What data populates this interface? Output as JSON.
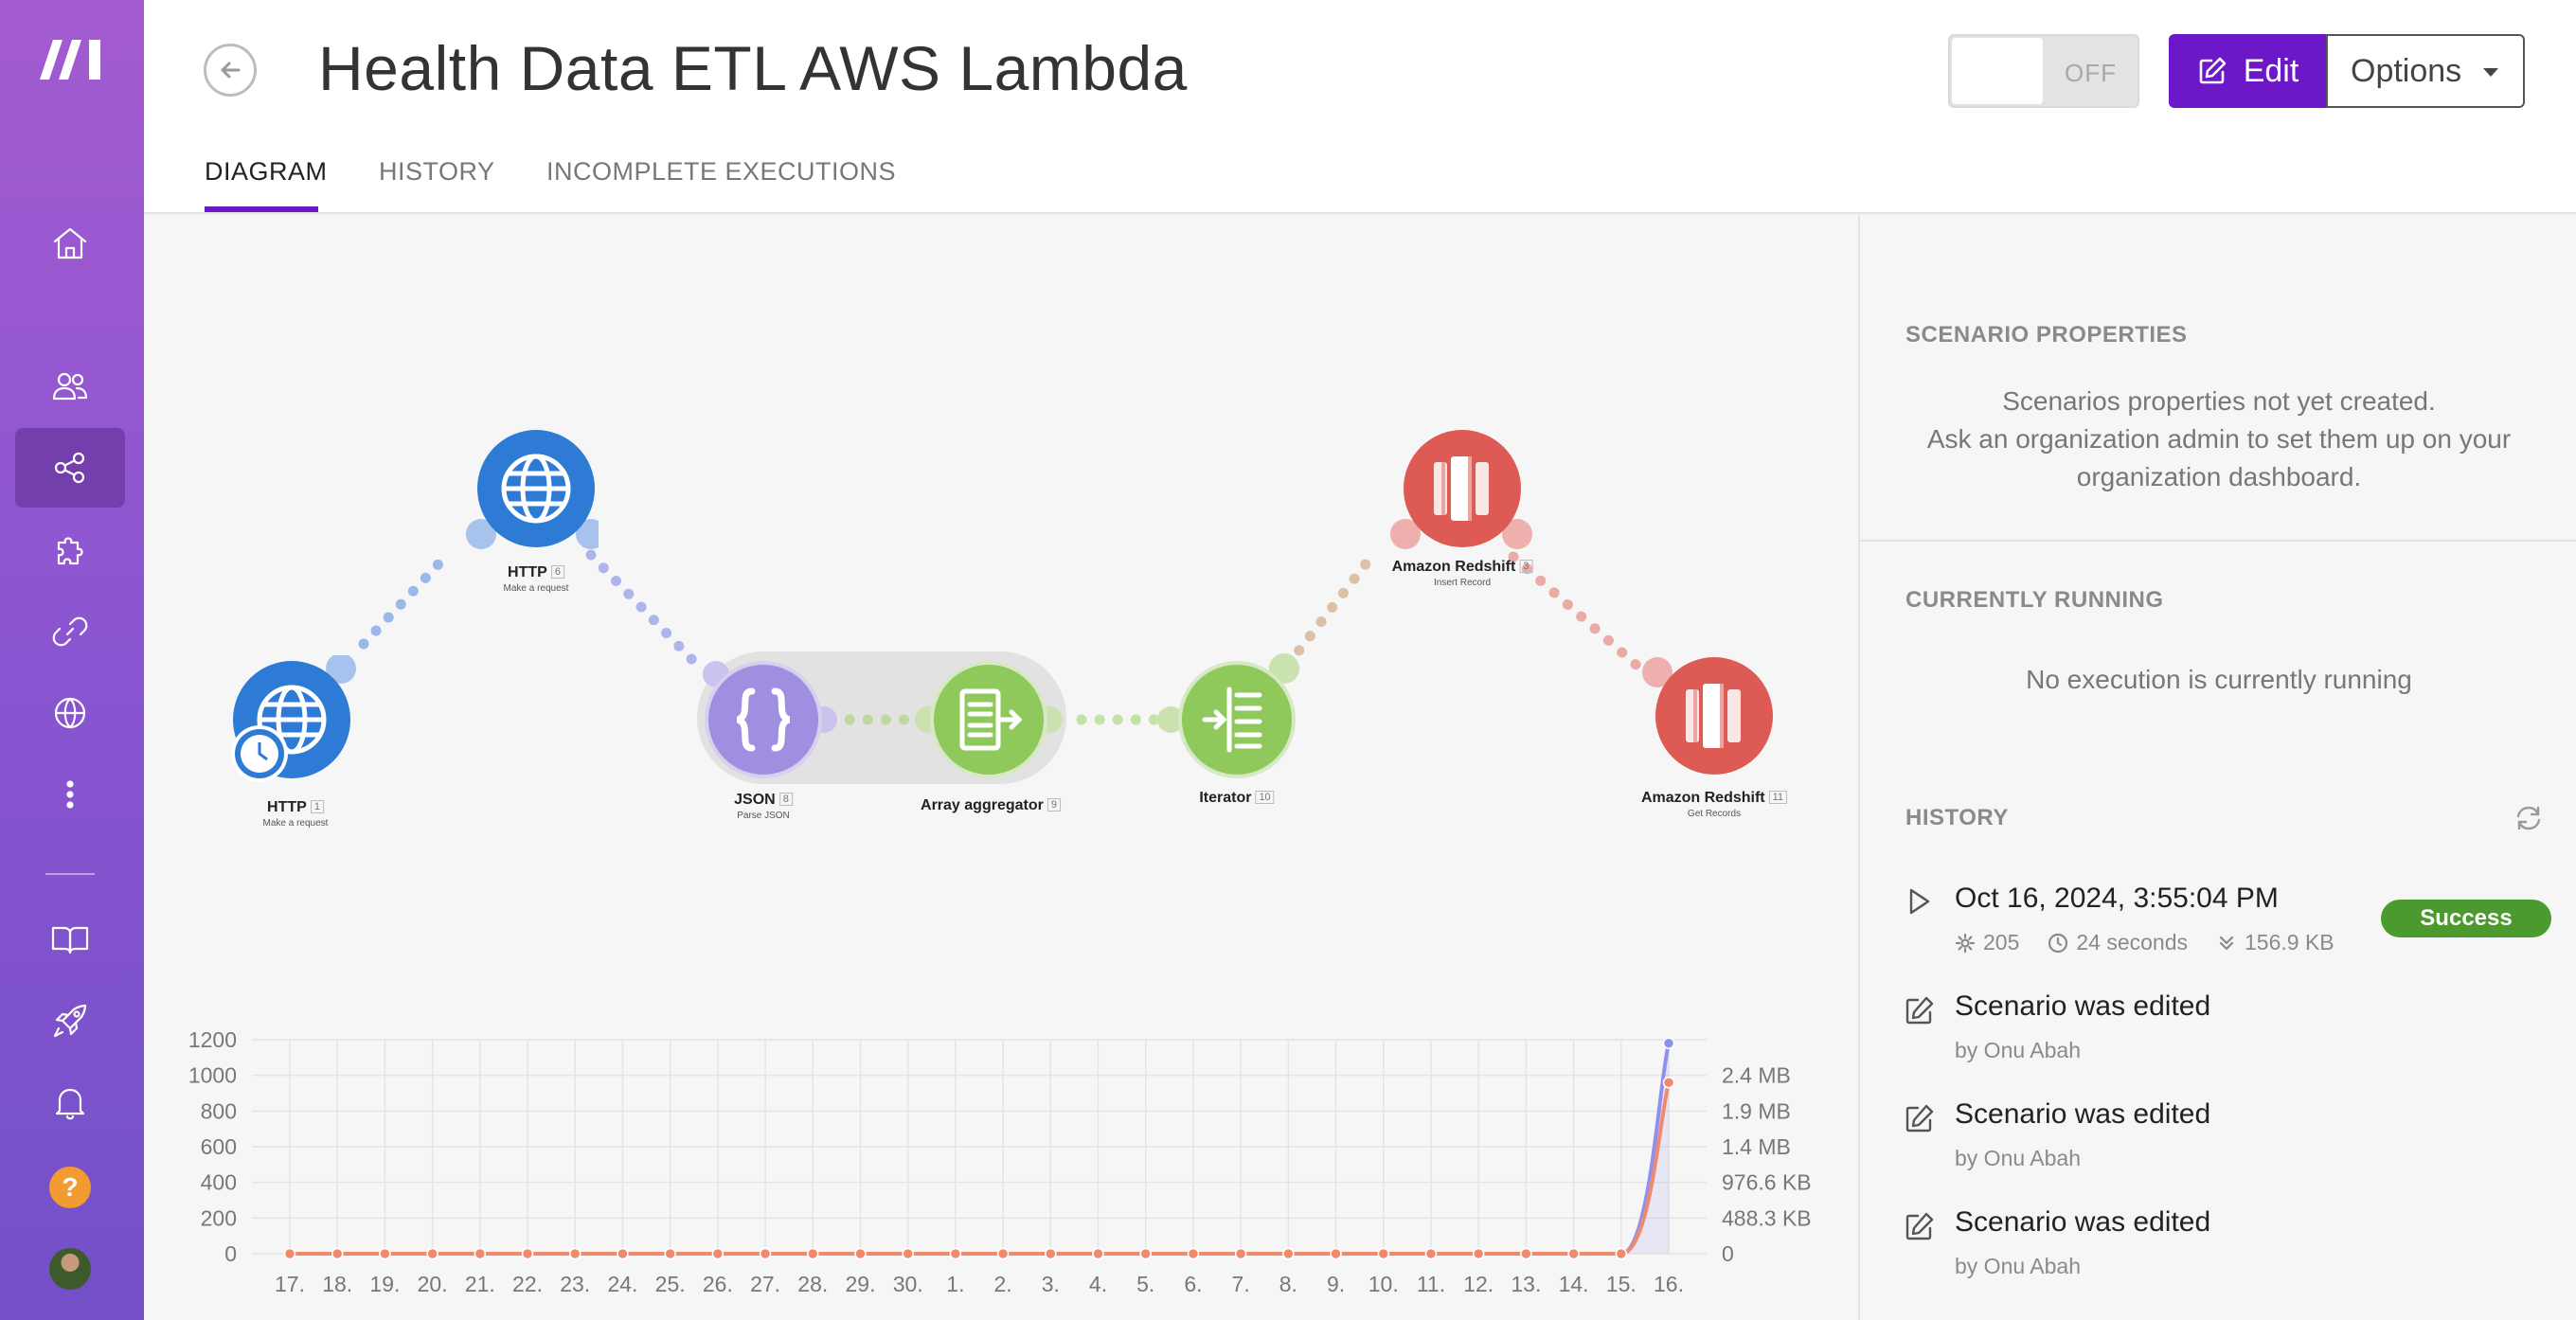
{
  "app": {
    "title": "Health Data ETL AWS Lambda",
    "toggle_label": "OFF",
    "edit_label": "Edit",
    "options_label": "Options"
  },
  "tabs": [
    {
      "label": "DIAGRAM",
      "active": true
    },
    {
      "label": "HISTORY",
      "active": false
    },
    {
      "label": "INCOMPLETE EXECUTIONS",
      "active": false
    }
  ],
  "sidebar": {
    "items": [
      {
        "icon": "home-icon"
      },
      {
        "icon": "users-icon"
      },
      {
        "icon": "share-icon",
        "active": true
      },
      {
        "icon": "puzzle-icon"
      },
      {
        "icon": "link-icon"
      },
      {
        "icon": "globe-icon"
      },
      {
        "icon": "more-vertical-icon"
      },
      {
        "icon": "book-icon"
      },
      {
        "icon": "rocket-icon"
      },
      {
        "icon": "bell-icon"
      }
    ],
    "help_label": "?"
  },
  "modules": [
    {
      "name": "HTTP",
      "num": "1",
      "sub": "Make a request",
      "color": "#2e7bd6"
    },
    {
      "name": "HTTP",
      "num": "6",
      "sub": "Make a request",
      "color": "#2e7bd6"
    },
    {
      "name": "JSON",
      "num": "8",
      "sub": "Parse JSON",
      "color": "#a08ee0"
    },
    {
      "name": "Array aggregator",
      "num": "9",
      "sub": "",
      "color": "#8fc95c"
    },
    {
      "name": "Iterator",
      "num": "10",
      "sub": "",
      "color": "#8fc95c"
    },
    {
      "name": "Amazon Redshift",
      "num": "3",
      "sub": "Insert Record",
      "color": "#dd5a55"
    },
    {
      "name": "Amazon Redshift",
      "num": "11",
      "sub": "Get Records",
      "color": "#dd5a55"
    }
  ],
  "chart_data": {
    "type": "line",
    "categories": [
      "17.",
      "18.",
      "19.",
      "20.",
      "21.",
      "22.",
      "23.",
      "24.",
      "25.",
      "26.",
      "27.",
      "28.",
      "29.",
      "30.",
      "1.",
      "2.",
      "3.",
      "4.",
      "5.",
      "6.",
      "7.",
      "8.",
      "9.",
      "10.",
      "11.",
      "12.",
      "13.",
      "14.",
      "15.",
      "16."
    ],
    "y_left_ticks": [
      "0",
      "200",
      "400",
      "600",
      "800",
      "1000",
      "1200"
    ],
    "y_left_range": [
      0,
      1200
    ],
    "y_right_ticks": [
      "0",
      "488.3 KB",
      "976.6 KB",
      "1.4 MB",
      "1.9 MB",
      "2.4 MB"
    ],
    "series": [
      {
        "color": "#8f8ff0",
        "axis": "left",
        "values": [
          0,
          0,
          0,
          0,
          0,
          0,
          0,
          0,
          0,
          0,
          0,
          0,
          0,
          0,
          0,
          0,
          0,
          0,
          0,
          0,
          0,
          0,
          0,
          0,
          0,
          0,
          0,
          0,
          0,
          1180
        ]
      },
      {
        "color": "#f08a6c",
        "axis": "left",
        "values": [
          0,
          0,
          0,
          0,
          0,
          0,
          0,
          0,
          0,
          0,
          0,
          0,
          0,
          0,
          0,
          0,
          0,
          0,
          0,
          0,
          0,
          0,
          0,
          0,
          0,
          0,
          0,
          0,
          0,
          960
        ]
      }
    ],
    "grid": true
  },
  "panel": {
    "props_title": "SCENARIO PROPERTIES",
    "props_text_1": "Scenarios properties not yet created.",
    "props_text_2": "Ask an organization admin to set them up on your",
    "props_text_3": "organization dashboard.",
    "running_title": "CURRENTLY RUNNING",
    "running_text": "No execution is currently running",
    "history_title": "HISTORY",
    "history": [
      {
        "type": "run",
        "title": "Oct 16, 2024, 3:55:04 PM",
        "ops": "205",
        "duration": "24 seconds",
        "size": "156.9 KB",
        "status": "Success"
      },
      {
        "type": "edit",
        "title": "Scenario was edited",
        "by": "by Onu Abah"
      },
      {
        "type": "edit",
        "title": "Scenario was edited",
        "by": "by Onu Abah"
      },
      {
        "type": "edit",
        "title": "Scenario was edited",
        "by": "by Onu Abah"
      }
    ]
  }
}
